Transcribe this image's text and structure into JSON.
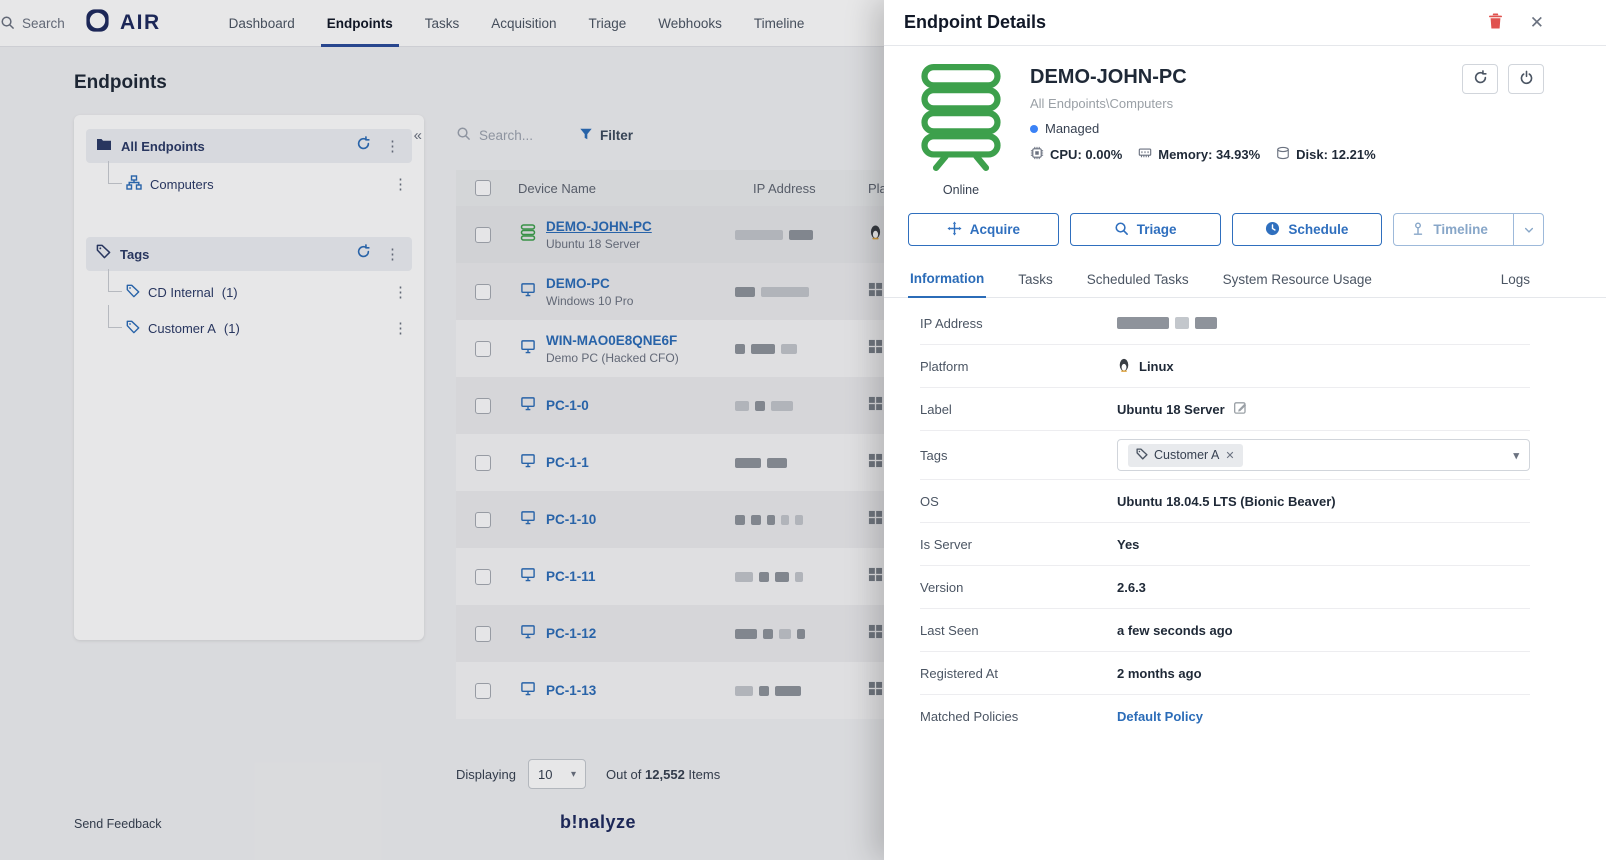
{
  "colors": {
    "accent_blue": "#2b6cb8",
    "brand_navy": "#1e2a5e",
    "status_green": "#3da04c",
    "danger_red": "#e0524f",
    "managed_dot": "#3b82f6"
  },
  "icons": {
    "close": "✕",
    "kebab": "⋮",
    "collapse": "«",
    "caret_down": "▾",
    "remove_tag": "✕"
  },
  "nav": {
    "brand": "AIR",
    "search_hint": "Search",
    "items": [
      {
        "label": "Dashboard"
      },
      {
        "label": "Endpoints"
      },
      {
        "label": "Tasks"
      },
      {
        "label": "Acquisition"
      },
      {
        "label": "Triage"
      },
      {
        "label": "Webhooks"
      },
      {
        "label": "Timeline"
      }
    ]
  },
  "page": {
    "title": "Endpoints"
  },
  "tree": {
    "all_endpoints": "All Endpoints",
    "computers": "Computers",
    "tags": "Tags",
    "tag_items": [
      {
        "label": "CD Internal",
        "count": "(1)"
      },
      {
        "label": "Customer A",
        "count": "(1)"
      }
    ]
  },
  "toolbar": {
    "search_placeholder": "Search...",
    "filter": "Filter"
  },
  "table": {
    "headers": {
      "device": "Device Name",
      "ip": "IP Address",
      "platform": "Platform"
    },
    "rows": [
      {
        "name": "DEMO-JOHN-PC",
        "sub": "Ubuntu 18 Server"
      },
      {
        "name": "DEMO-PC",
        "sub": "Windows 10 Pro"
      },
      {
        "name": "WIN-MAO0E8QNE6F",
        "sub": "Demo PC (Hacked CFO)"
      },
      {
        "name": "PC-1-0",
        "sub": ""
      },
      {
        "name": "PC-1-1",
        "sub": ""
      },
      {
        "name": "PC-1-10",
        "sub": ""
      },
      {
        "name": "PC-1-11",
        "sub": ""
      },
      {
        "name": "PC-1-12",
        "sub": ""
      },
      {
        "name": "PC-1-13",
        "sub": ""
      }
    ]
  },
  "pagination": {
    "displaying": "Displaying",
    "page_size": "10",
    "out_of": "Out of",
    "total": "12,552",
    "items": "Items"
  },
  "footer": {
    "feedback": "Send Feedback",
    "logo": "b!nalyze"
  },
  "drawer": {
    "title": "Endpoint Details",
    "device": {
      "name": "DEMO-JOHN-PC",
      "path": "All Endpoints\\Computers",
      "status": "Managed",
      "online": "Online",
      "cpu": "CPU: 0.00%",
      "memory": "Memory: 34.93%",
      "disk": "Disk: 12.21%"
    },
    "actions": {
      "acquire": "Acquire",
      "triage": "Triage",
      "schedule": "Schedule",
      "timeline": "Timeline"
    },
    "tabs": [
      "Information",
      "Tasks",
      "Scheduled Tasks",
      "System Resource Usage",
      "Logs"
    ],
    "details": [
      {
        "label": "IP Address",
        "value": ""
      },
      {
        "label": "Platform",
        "value": "Linux"
      },
      {
        "label": "Label",
        "value": "Ubuntu 18 Server"
      },
      {
        "label": "Tags",
        "value": "Customer A"
      },
      {
        "label": "OS",
        "value": "Ubuntu 18.04.5 LTS (Bionic Beaver)"
      },
      {
        "label": "Is Server",
        "value": "Yes"
      },
      {
        "label": "Version",
        "value": "2.6.3"
      },
      {
        "label": "Last Seen",
        "value": "a few seconds ago"
      },
      {
        "label": "Registered At",
        "value": "2 months ago"
      },
      {
        "label": "Matched Policies",
        "value": "Default Policy"
      }
    ]
  }
}
